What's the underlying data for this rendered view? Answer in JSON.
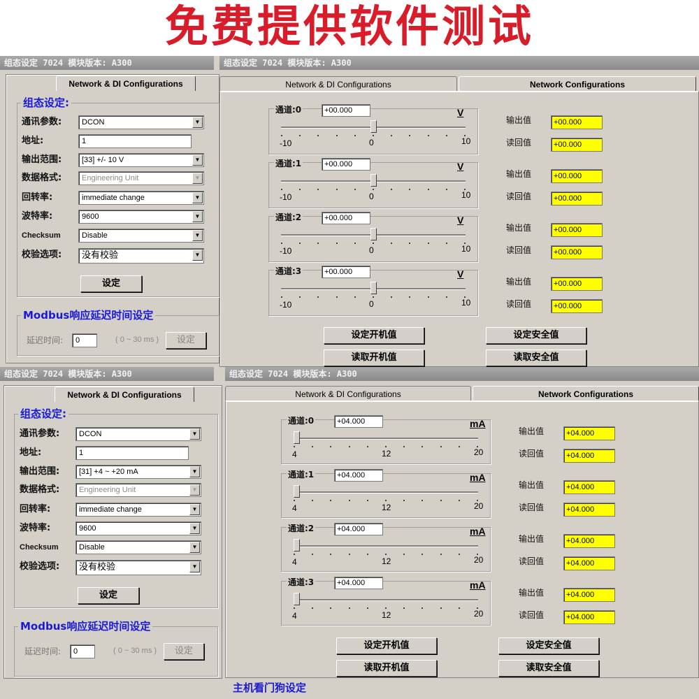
{
  "banner": {
    "text": "免费提供软件测试"
  },
  "title_bar": "组态设定 7024 模块版本: A300",
  "tabs": {
    "network_di": "Network & DI Configurations",
    "network": "Network Configurations"
  },
  "config": {
    "group_title": "组态设定:",
    "labels": {
      "comm": "通讯参数:",
      "address": "地址:",
      "output_range": "输出范围:",
      "data_format": "数据格式:",
      "slew_rate": "回转率:",
      "baud_rate": "波特率:",
      "checksum": "Checksum",
      "check_option": "校验选项:"
    },
    "values": {
      "comm": "DCON",
      "address": "1",
      "data_format": "Engineering Unit",
      "slew_rate": "immediate change",
      "baud_rate": "9600",
      "checksum": "Disable",
      "check_option": "没有校验"
    },
    "set_button": "设定"
  },
  "modbus": {
    "group_title": "Modbus响应延迟时间设定",
    "delay_label": "延迟时间:",
    "delay_value": "0",
    "range": "( 0 ~ 30 ms )",
    "set_button": "设定"
  },
  "io_labels": {
    "output": "输出值",
    "readback": "读回值"
  },
  "buttons": {
    "set_power_on": "设定开机值",
    "read_power_on": "读取开机值",
    "set_safe": "设定安全值",
    "read_safe": "读取安全值"
  },
  "window_voltage": {
    "output_range": "[33] +/- 10 V",
    "unit": "V",
    "scale": [
      "-10",
      "0",
      "10"
    ],
    "channels": [
      {
        "label": "通道:0",
        "value": "+00.000",
        "output": "+00.000",
        "readback": "+00.000",
        "slider_fraction": 0.5
      },
      {
        "label": "通道:1",
        "value": "+00.000",
        "output": "+00.000",
        "readback": "+00.000",
        "slider_fraction": 0.5
      },
      {
        "label": "通道:2",
        "value": "+00.000",
        "output": "+00.000",
        "readback": "+00.000",
        "slider_fraction": 0.5
      },
      {
        "label": "通道:3",
        "value": "+00.000",
        "output": "+00.000",
        "readback": "+00.000",
        "slider_fraction": 0.5
      }
    ]
  },
  "window_current": {
    "output_range": "[31] +4 ~ +20 mA",
    "unit": "mA",
    "scale": [
      "4",
      "12",
      "20"
    ],
    "channels": [
      {
        "label": "通道:0",
        "value": "+04.000",
        "output": "+04.000",
        "readback": "+04.000",
        "slider_fraction": 0.0
      },
      {
        "label": "通道:1",
        "value": "+04.000",
        "output": "+04.000",
        "readback": "+04.000",
        "slider_fraction": 0.0
      },
      {
        "label": "通道:2",
        "value": "+04.000",
        "output": "+04.000",
        "readback": "+04.000",
        "slider_fraction": 0.0
      },
      {
        "label": "通道:3",
        "value": "+04.000",
        "output": "+04.000",
        "readback": "+04.000",
        "slider_fraction": 0.0
      }
    ]
  },
  "watchdog": {
    "title": "主机看门狗设定"
  },
  "colors": {
    "banner_red": "#d81c2a",
    "group_title_blue": "#1a1ad6",
    "field_yellow": "#ffff00",
    "window_gray": "#d4d0c8"
  }
}
